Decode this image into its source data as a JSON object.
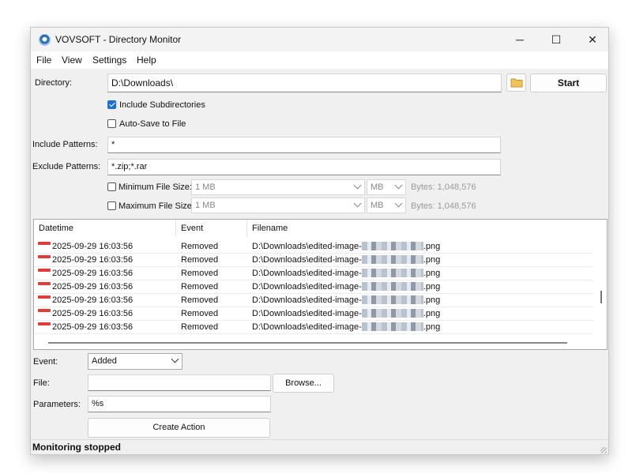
{
  "window": {
    "title": "VOVSOFT - Directory Monitor"
  },
  "titlebar": {
    "minimize": "─",
    "maximize": "☐",
    "close": "✕"
  },
  "menu": [
    "File",
    "View",
    "Settings",
    "Help"
  ],
  "directory": {
    "label": "Directory:",
    "value": "D:\\Downloads\\",
    "start_label": "Start"
  },
  "options": {
    "include_subdirs": {
      "label": "Include Subdirectories",
      "checked": true
    },
    "auto_save": {
      "label": "Auto-Save to File",
      "checked": false
    }
  },
  "patterns": {
    "include_label": "Include Patterns:",
    "include_value": "*",
    "exclude_label": "Exclude Patterns:",
    "exclude_value": "*.zip;*.rar"
  },
  "filesize": {
    "min": {
      "label": "Minimum File Size:",
      "value": "1 MB",
      "unit": "MB",
      "bytes": "Bytes:  1,048,576"
    },
    "max": {
      "label": "Maximum File Size:",
      "value": "1 MB",
      "unit": "MB",
      "bytes": "Bytes:  1,048,576"
    }
  },
  "table": {
    "columns": [
      "Datetime",
      "Event",
      "Filename"
    ],
    "rows": [
      {
        "datetime": "2025-09-29 16:03:56",
        "event": "Removed",
        "filename_prefix": "D:\\Downloads\\edited-image-",
        "filename_suffix": ".png"
      },
      {
        "datetime": "2025-09-29 16:03:56",
        "event": "Removed",
        "filename_prefix": "D:\\Downloads\\edited-image-",
        "filename_suffix": ".png"
      },
      {
        "datetime": "2025-09-29 16:03:56",
        "event": "Removed",
        "filename_prefix": "D:\\Downloads\\edited-image-",
        "filename_suffix": ".png"
      },
      {
        "datetime": "2025-09-29 16:03:56",
        "event": "Removed",
        "filename_prefix": "D:\\Downloads\\edited-image-",
        "filename_suffix": ".png"
      },
      {
        "datetime": "2025-09-29 16:03:56",
        "event": "Removed",
        "filename_prefix": "D:\\Downloads\\edited-image-",
        "filename_suffix": ".png"
      },
      {
        "datetime": "2025-09-29 16:03:56",
        "event": "Removed",
        "filename_prefix": "D:\\Downloads\\edited-image-",
        "filename_suffix": ".png"
      },
      {
        "datetime": "2025-09-29 16:03:56",
        "event": "Removed",
        "filename_prefix": "D:\\Downloads\\edited-image-",
        "filename_suffix": ".png"
      }
    ]
  },
  "action": {
    "event_label": "Event:",
    "event_value": "Added",
    "file_label": "File:",
    "file_value": "",
    "browse_label": "Browse...",
    "params_label": "Parameters:",
    "params_value": "%s",
    "create_label": "Create Action"
  },
  "status": {
    "text": "Monitoring stopped"
  },
  "colors": {
    "accent": "#1f6fd0",
    "removed_icon": "#e03c3c"
  }
}
